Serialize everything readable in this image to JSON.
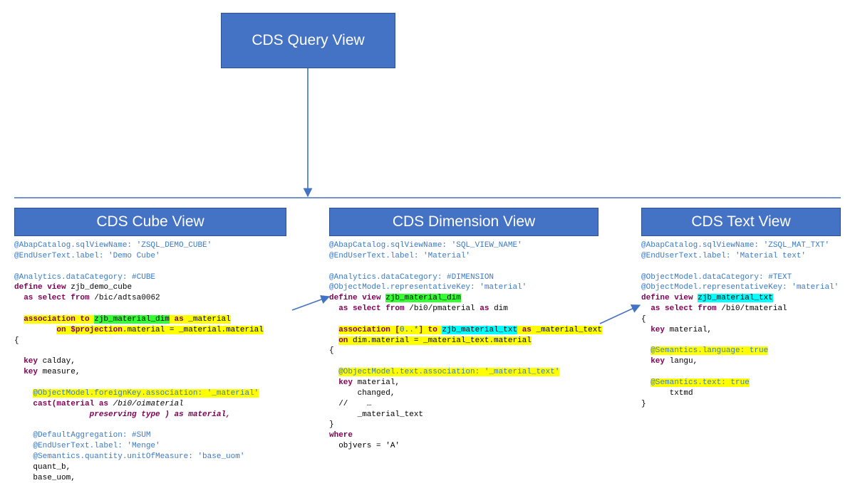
{
  "top": {
    "title": "CDS Query View"
  },
  "cube": {
    "title": "CDS Cube View",
    "a_sqlview": "@AbapCatalog.sqlViewName: 'ZSQL_DEMO_CUBE'",
    "a_label": "@EndUserText.label: 'Demo Cube'",
    "a_cat": "@Analytics.dataCategory: #CUBE",
    "kw_define": "define view",
    "view_name": "zjb_demo_cube",
    "kw_as_sel": "as select from",
    "from_src": "/bic/adtsa0062",
    "assoc_kw": "association to",
    "assoc_tgt": "zjb_material_dim",
    "assoc_as": "as",
    "assoc_alias": "_material",
    "assoc_on": "on $projection",
    "assoc_on2": ".material = _material.material",
    "key_calday": "key",
    "f_calday": "calday,",
    "key_meas": "key",
    "f_meas": "measure,",
    "fk_anno": "@ObjectModel.foreignKey.association: '_material'",
    "cast_ln": "cast(material as",
    "cast_type": "/bi0/oimaterial",
    "cast_ln2": "preserving type ) as material,",
    "agg_anno": "@DefaultAggregation: #SUM",
    "eut_anno": "@EndUserText.label: 'Menge'",
    "sem_anno": "@Semantics.quantity.unitOfMeasure: 'base_uom'",
    "f_quant": "quant_b,",
    "f_uom": "base_uom,"
  },
  "dim": {
    "title": "CDS Dimension View",
    "a_sqlview": "@AbapCatalog.sqlViewName: 'SQL_VIEW_NAME'",
    "a_label": "@EndUserText.label: 'Material'",
    "a_cat": "@Analytics.dataCategory: #DIMENSION",
    "a_repkey": "@ObjectModel.representativeKey: 'material'",
    "kw_define": "define view",
    "view_name": "zjb_material_dim",
    "kw_as_sel": "as select from",
    "from_src": "/bi0/pmaterial",
    "kw_as": "as",
    "from_alias": "dim",
    "assoc_kw": "association [",
    "card": "0..*",
    "assoc_to": "] to",
    "assoc_tgt": "zjb_material_txt",
    "assoc_as": "as",
    "assoc_alias": "_material_text",
    "assoc_on": "on",
    "assoc_on2": "dim.material = _material_text.material",
    "txt_anno": "@ObjectModel.text.association: '_material_text'",
    "key": "key",
    "f_material": "material,",
    "f_changed": "changed,",
    "f_dots": "//    …",
    "f_assoc": "_material_text",
    "where": "where",
    "where_c": "objvers = 'A'"
  },
  "text": {
    "title": "CDS Text View",
    "a_sqlview": "@AbapCatalog.sqlViewName: 'ZSQL_MAT_TXT'",
    "a_label": "@EndUserText.label: 'Material text'",
    "a_cat": "@ObjectModel.dataCategory: #TEXT",
    "a_repkey": "@ObjectModel.representativeKey: 'material'",
    "kw_define": "define view",
    "view_name": "zjb_material_txt",
    "kw_as_sel": "as select from",
    "from_src": "/bi0/tmaterial",
    "key": "key",
    "f_material": "material,",
    "sem_lang": "@Semantics.language: true",
    "key2": "key",
    "f_langu": "langu,",
    "sem_text": "@Semantics.text: true",
    "f_txtmd": "txtmd"
  }
}
